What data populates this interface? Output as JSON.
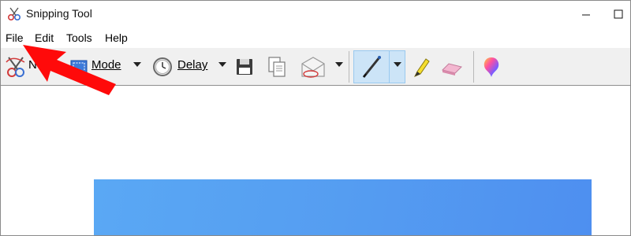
{
  "window": {
    "title": "Snipping Tool",
    "controls": {
      "minimize": "minimize",
      "maximize": "maximize"
    }
  },
  "menu": {
    "items": [
      "File",
      "Edit",
      "Tools",
      "Help"
    ]
  },
  "toolbar": {
    "new_label_visible": "Ne",
    "new_label_full": "New",
    "mode_label": "Mode",
    "delay_label": "Delay",
    "icons": [
      "new-snip-icon",
      "mode-icon",
      "delay-clock-icon",
      "save-icon",
      "copy-icon",
      "send-email-icon",
      "pen-icon",
      "highlighter-icon",
      "eraser-icon",
      "paint3d-icon"
    ],
    "active_tool": "pen"
  },
  "canvas": {
    "capture_color_start": "#5aa8f4",
    "capture_color_end": "#4e8ff0"
  },
  "annotation": {
    "arrow_color": "#ff0000"
  }
}
